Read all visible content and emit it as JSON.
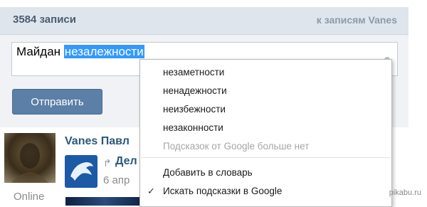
{
  "header": {
    "count": "3584 записи",
    "link": "к записям Vanes"
  },
  "editor": {
    "text_before": "Майдан ",
    "text_selected": "незалежности"
  },
  "send_button": "Отправить",
  "post": {
    "author": "Vanes Павл",
    "title": "Дел",
    "date": "6 апр",
    "status": "Online"
  },
  "context_menu": {
    "suggestions": [
      "незаметности",
      "ненадежности",
      "неизбежности",
      "незаконности"
    ],
    "no_more": "Подсказок от Google больше нет",
    "add_to_dict": "Добавить в словарь",
    "google_hints": "Искать подсказки в Google",
    "google_hints_checked": true
  },
  "watermark": "pikabu.ru",
  "colors": {
    "header_bg": "#dee5ec",
    "button_bg": "#5b7fa6",
    "selection": "#3399ff",
    "link": "#2b587a"
  },
  "icons": [
    "share-icon",
    "check-icon",
    "dolphin-image",
    "avatar-image"
  ]
}
